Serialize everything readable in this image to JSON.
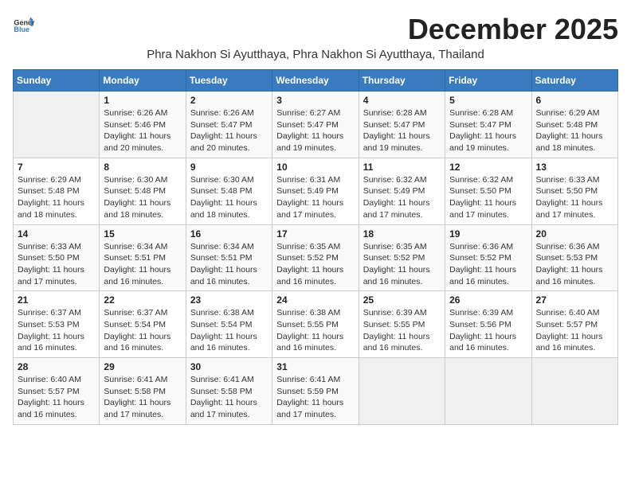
{
  "header": {
    "logo_general": "General",
    "logo_blue": "Blue",
    "month_title": "December 2025",
    "subtitle": "Phra Nakhon Si Ayutthaya, Phra Nakhon Si Ayutthaya, Thailand"
  },
  "weekdays": [
    "Sunday",
    "Monday",
    "Tuesday",
    "Wednesday",
    "Thursday",
    "Friday",
    "Saturday"
  ],
  "weeks": [
    [
      {
        "day": "",
        "sunrise": "",
        "sunset": "",
        "daylight": ""
      },
      {
        "day": "1",
        "sunrise": "Sunrise: 6:26 AM",
        "sunset": "Sunset: 5:46 PM",
        "daylight": "Daylight: 11 hours and 20 minutes."
      },
      {
        "day": "2",
        "sunrise": "Sunrise: 6:26 AM",
        "sunset": "Sunset: 5:47 PM",
        "daylight": "Daylight: 11 hours and 20 minutes."
      },
      {
        "day": "3",
        "sunrise": "Sunrise: 6:27 AM",
        "sunset": "Sunset: 5:47 PM",
        "daylight": "Daylight: 11 hours and 19 minutes."
      },
      {
        "day": "4",
        "sunrise": "Sunrise: 6:28 AM",
        "sunset": "Sunset: 5:47 PM",
        "daylight": "Daylight: 11 hours and 19 minutes."
      },
      {
        "day": "5",
        "sunrise": "Sunrise: 6:28 AM",
        "sunset": "Sunset: 5:47 PM",
        "daylight": "Daylight: 11 hours and 19 minutes."
      },
      {
        "day": "6",
        "sunrise": "Sunrise: 6:29 AM",
        "sunset": "Sunset: 5:48 PM",
        "daylight": "Daylight: 11 hours and 18 minutes."
      }
    ],
    [
      {
        "day": "7",
        "sunrise": "Sunrise: 6:29 AM",
        "sunset": "Sunset: 5:48 PM",
        "daylight": "Daylight: 11 hours and 18 minutes."
      },
      {
        "day": "8",
        "sunrise": "Sunrise: 6:30 AM",
        "sunset": "Sunset: 5:48 PM",
        "daylight": "Daylight: 11 hours and 18 minutes."
      },
      {
        "day": "9",
        "sunrise": "Sunrise: 6:30 AM",
        "sunset": "Sunset: 5:48 PM",
        "daylight": "Daylight: 11 hours and 18 minutes."
      },
      {
        "day": "10",
        "sunrise": "Sunrise: 6:31 AM",
        "sunset": "Sunset: 5:49 PM",
        "daylight": "Daylight: 11 hours and 17 minutes."
      },
      {
        "day": "11",
        "sunrise": "Sunrise: 6:32 AM",
        "sunset": "Sunset: 5:49 PM",
        "daylight": "Daylight: 11 hours and 17 minutes."
      },
      {
        "day": "12",
        "sunrise": "Sunrise: 6:32 AM",
        "sunset": "Sunset: 5:50 PM",
        "daylight": "Daylight: 11 hours and 17 minutes."
      },
      {
        "day": "13",
        "sunrise": "Sunrise: 6:33 AM",
        "sunset": "Sunset: 5:50 PM",
        "daylight": "Daylight: 11 hours and 17 minutes."
      }
    ],
    [
      {
        "day": "14",
        "sunrise": "Sunrise: 6:33 AM",
        "sunset": "Sunset: 5:50 PM",
        "daylight": "Daylight: 11 hours and 17 minutes."
      },
      {
        "day": "15",
        "sunrise": "Sunrise: 6:34 AM",
        "sunset": "Sunset: 5:51 PM",
        "daylight": "Daylight: 11 hours and 16 minutes."
      },
      {
        "day": "16",
        "sunrise": "Sunrise: 6:34 AM",
        "sunset": "Sunset: 5:51 PM",
        "daylight": "Daylight: 11 hours and 16 minutes."
      },
      {
        "day": "17",
        "sunrise": "Sunrise: 6:35 AM",
        "sunset": "Sunset: 5:52 PM",
        "daylight": "Daylight: 11 hours and 16 minutes."
      },
      {
        "day": "18",
        "sunrise": "Sunrise: 6:35 AM",
        "sunset": "Sunset: 5:52 PM",
        "daylight": "Daylight: 11 hours and 16 minutes."
      },
      {
        "day": "19",
        "sunrise": "Sunrise: 6:36 AM",
        "sunset": "Sunset: 5:52 PM",
        "daylight": "Daylight: 11 hours and 16 minutes."
      },
      {
        "day": "20",
        "sunrise": "Sunrise: 6:36 AM",
        "sunset": "Sunset: 5:53 PM",
        "daylight": "Daylight: 11 hours and 16 minutes."
      }
    ],
    [
      {
        "day": "21",
        "sunrise": "Sunrise: 6:37 AM",
        "sunset": "Sunset: 5:53 PM",
        "daylight": "Daylight: 11 hours and 16 minutes."
      },
      {
        "day": "22",
        "sunrise": "Sunrise: 6:37 AM",
        "sunset": "Sunset: 5:54 PM",
        "daylight": "Daylight: 11 hours and 16 minutes."
      },
      {
        "day": "23",
        "sunrise": "Sunrise: 6:38 AM",
        "sunset": "Sunset: 5:54 PM",
        "daylight": "Daylight: 11 hours and 16 minutes."
      },
      {
        "day": "24",
        "sunrise": "Sunrise: 6:38 AM",
        "sunset": "Sunset: 5:55 PM",
        "daylight": "Daylight: 11 hours and 16 minutes."
      },
      {
        "day": "25",
        "sunrise": "Sunrise: 6:39 AM",
        "sunset": "Sunset: 5:55 PM",
        "daylight": "Daylight: 11 hours and 16 minutes."
      },
      {
        "day": "26",
        "sunrise": "Sunrise: 6:39 AM",
        "sunset": "Sunset: 5:56 PM",
        "daylight": "Daylight: 11 hours and 16 minutes."
      },
      {
        "day": "27",
        "sunrise": "Sunrise: 6:40 AM",
        "sunset": "Sunset: 5:57 PM",
        "daylight": "Daylight: 11 hours and 16 minutes."
      }
    ],
    [
      {
        "day": "28",
        "sunrise": "Sunrise: 6:40 AM",
        "sunset": "Sunset: 5:57 PM",
        "daylight": "Daylight: 11 hours and 16 minutes."
      },
      {
        "day": "29",
        "sunrise": "Sunrise: 6:41 AM",
        "sunset": "Sunset: 5:58 PM",
        "daylight": "Daylight: 11 hours and 17 minutes."
      },
      {
        "day": "30",
        "sunrise": "Sunrise: 6:41 AM",
        "sunset": "Sunset: 5:58 PM",
        "daylight": "Daylight: 11 hours and 17 minutes."
      },
      {
        "day": "31",
        "sunrise": "Sunrise: 6:41 AM",
        "sunset": "Sunset: 5:59 PM",
        "daylight": "Daylight: 11 hours and 17 minutes."
      },
      {
        "day": "",
        "sunrise": "",
        "sunset": "",
        "daylight": ""
      },
      {
        "day": "",
        "sunrise": "",
        "sunset": "",
        "daylight": ""
      },
      {
        "day": "",
        "sunrise": "",
        "sunset": "",
        "daylight": ""
      }
    ]
  ]
}
